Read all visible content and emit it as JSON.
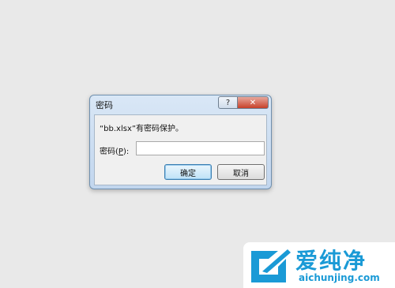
{
  "dialog": {
    "title": "密码",
    "help_symbol": "?",
    "close_symbol": "✕",
    "message": "“bb.xlsx”有密码保护。",
    "password_label_prefix": "密码(",
    "password_label_key": "P",
    "password_label_suffix": "):",
    "password_value": "",
    "ok_label": "确定",
    "cancel_label": "取消"
  },
  "watermark": {
    "name": "爱纯净",
    "url": "aichunjing.com"
  },
  "colors": {
    "background": "#e9e9e9",
    "accent": "#1a9ad6",
    "close_red": "#c7412b"
  }
}
